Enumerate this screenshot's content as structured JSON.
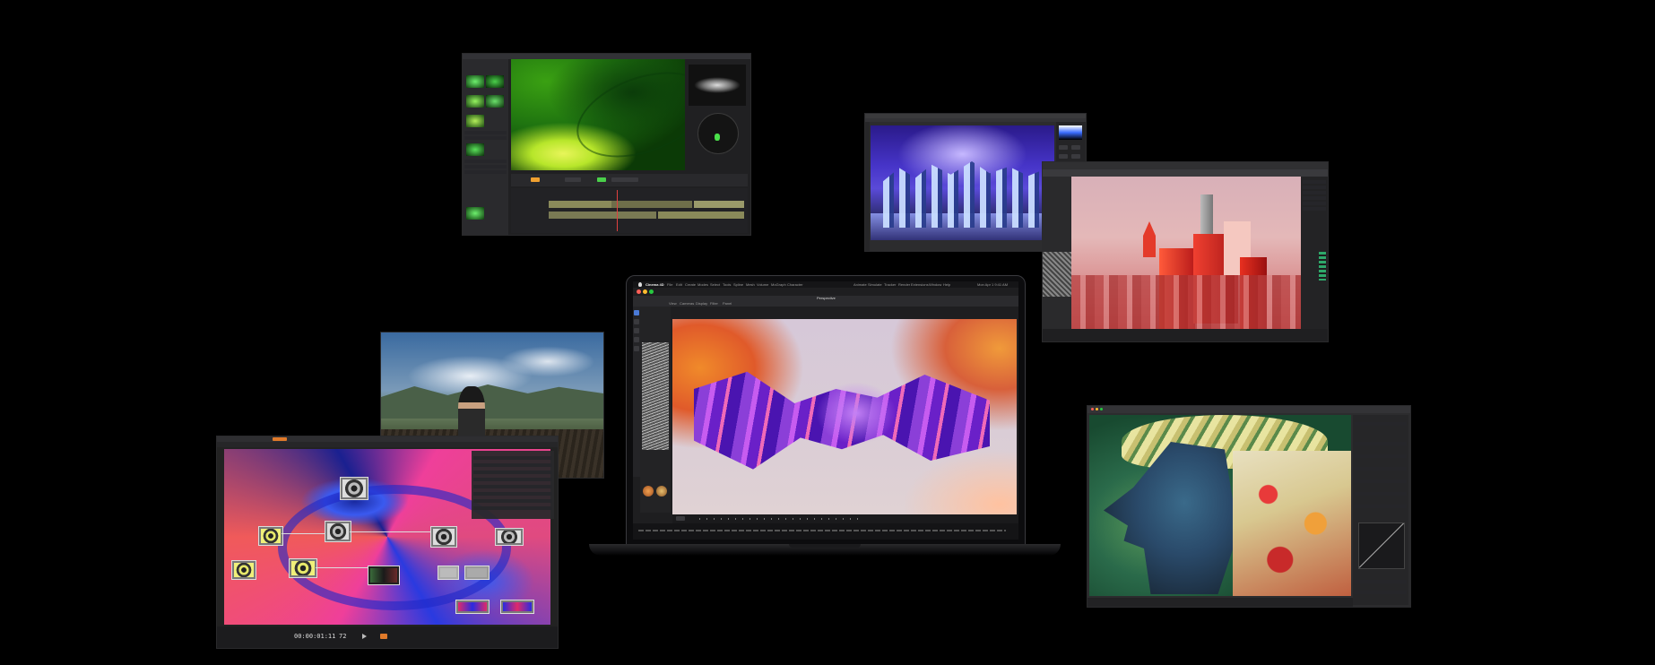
{
  "colors": {
    "background": "#000000",
    "chrome": "#1b1b1d",
    "macbook_bezel": "#0c0c0e",
    "accent_purple": "#8b3fd8",
    "accent_orange": "#f08a2a",
    "accent_pink": "#ef3f9a",
    "accent_green": "#5fd02a"
  },
  "icons": [
    "apple-icon",
    "traffic-light-icons",
    "play-icon",
    "tool-icons"
  ],
  "macbook": {
    "menubar": {
      "app": "Cinema 4D",
      "items": [
        "File",
        "Edit",
        "Create",
        "Modes",
        "Select",
        "Tools",
        "Spline",
        "Mesh",
        "Volume",
        "MoGraph",
        "Character",
        "Animate",
        "Simulate",
        "Tracker",
        "Render",
        "Extensions",
        "Window",
        "Help"
      ],
      "clock": "Mon Apr 1 9:41 AM"
    },
    "viewport_title": "Perspective",
    "toolbar_tabs": [
      "View",
      "Cameras",
      "Display",
      "Filter",
      "Panel"
    ]
  },
  "node_editor": {
    "timecode": "00:00:01:11",
    "frame": "72"
  }
}
